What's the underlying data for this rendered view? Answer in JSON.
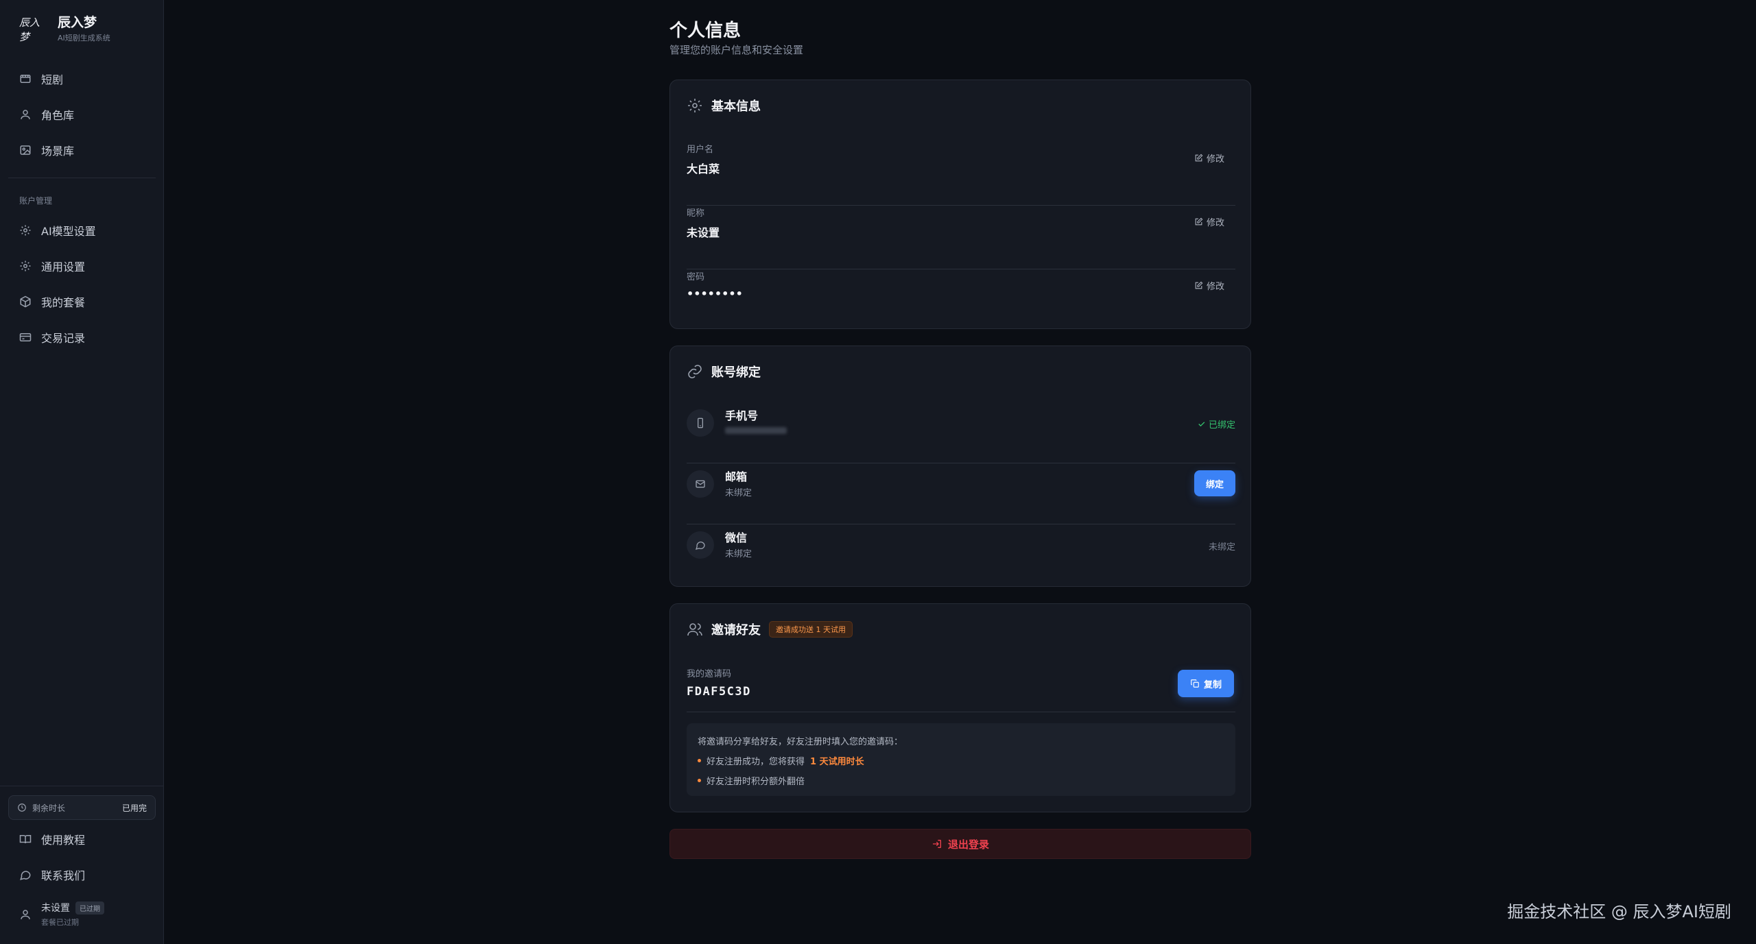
{
  "brand": {
    "logo_text": "辰入梦",
    "name": "辰入梦",
    "subtitle": "AI短剧生成系统"
  },
  "sidebar": {
    "items": [
      {
        "label": "短剧",
        "icon": "film-icon"
      },
      {
        "label": "角色库",
        "icon": "user-icon"
      },
      {
        "label": "场景库",
        "icon": "image-icon"
      }
    ],
    "section_label": "账户管理",
    "account_items": [
      {
        "label": "AI模型设置",
        "icon": "gear-icon"
      },
      {
        "label": "通用设置",
        "icon": "gear-icon"
      },
      {
        "label": "我的套餐",
        "icon": "box-icon"
      },
      {
        "label": "交易记录",
        "icon": "card-icon"
      }
    ],
    "remaining": {
      "label": "剩余时长",
      "value": "已用完"
    },
    "bottom_items": [
      {
        "label": "使用教程",
        "icon": "book-icon"
      },
      {
        "label": "联系我们",
        "icon": "chat-icon"
      }
    ],
    "user": {
      "name": "未设置",
      "badge": "已过期",
      "sub": "套餐已过期"
    }
  },
  "page": {
    "title": "个人信息",
    "subtitle": "管理您的账户信息和安全设置"
  },
  "basic": {
    "title": "基本信息",
    "edit_label": "修改",
    "rows": [
      {
        "label": "用户名",
        "value": "大白菜"
      },
      {
        "label": "昵称",
        "value": "未设置"
      },
      {
        "label": "密码",
        "value": "••••••••"
      }
    ]
  },
  "binding": {
    "title": "账号绑定",
    "phone": {
      "name": "手机号",
      "status": "已绑定"
    },
    "email": {
      "name": "邮箱",
      "sub": "未绑定",
      "button": "绑定"
    },
    "wechat": {
      "name": "微信",
      "sub": "未绑定",
      "status": "未绑定"
    }
  },
  "invite": {
    "title": "邀请好友",
    "tag": "邀请成功送 1 天试用",
    "code_label": "我的邀请码",
    "code": "FDAF5C3D",
    "copy_button": "复制",
    "info_line": "将邀请码分享给好友，好友注册时填入您的邀请码：",
    "bullet1": "好友注册成功，您将获得",
    "bullet1_highlight": "1 天试用时长",
    "bullet2": "好友注册时积分额外翻倍"
  },
  "logout": {
    "label": "退出登录"
  },
  "watermark": "掘金技术社区 @ 辰入梦AI短剧",
  "colors": {
    "accent": "#3b82f6",
    "success": "#34c36e",
    "danger": "#f0424f",
    "highlight": "#ff8a3d"
  }
}
